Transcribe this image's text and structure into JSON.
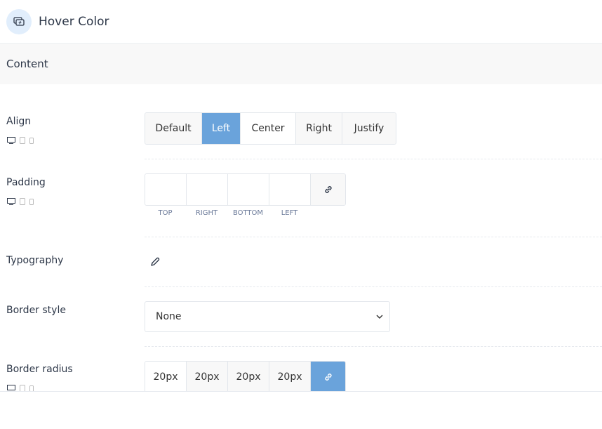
{
  "header": {
    "title": "Hover Color",
    "icon": "hover-color-icon"
  },
  "section": {
    "title": "Content"
  },
  "align": {
    "label": "Align",
    "options": [
      "Default",
      "Left",
      "Center",
      "Right",
      "Justify"
    ],
    "selected": "Left"
  },
  "padding": {
    "label": "Padding",
    "sides": [
      "TOP",
      "RIGHT",
      "BOTTOM",
      "LEFT"
    ],
    "values": [
      "",
      "",
      "",
      ""
    ]
  },
  "typography": {
    "label": "Typography"
  },
  "border_style": {
    "label": "Border style",
    "value": "None"
  },
  "border_radius": {
    "label": "Border radius",
    "values": [
      "20px",
      "20px",
      "20px",
      "20px"
    ],
    "linked": true
  },
  "colors": {
    "accent": "#6aa3db"
  }
}
